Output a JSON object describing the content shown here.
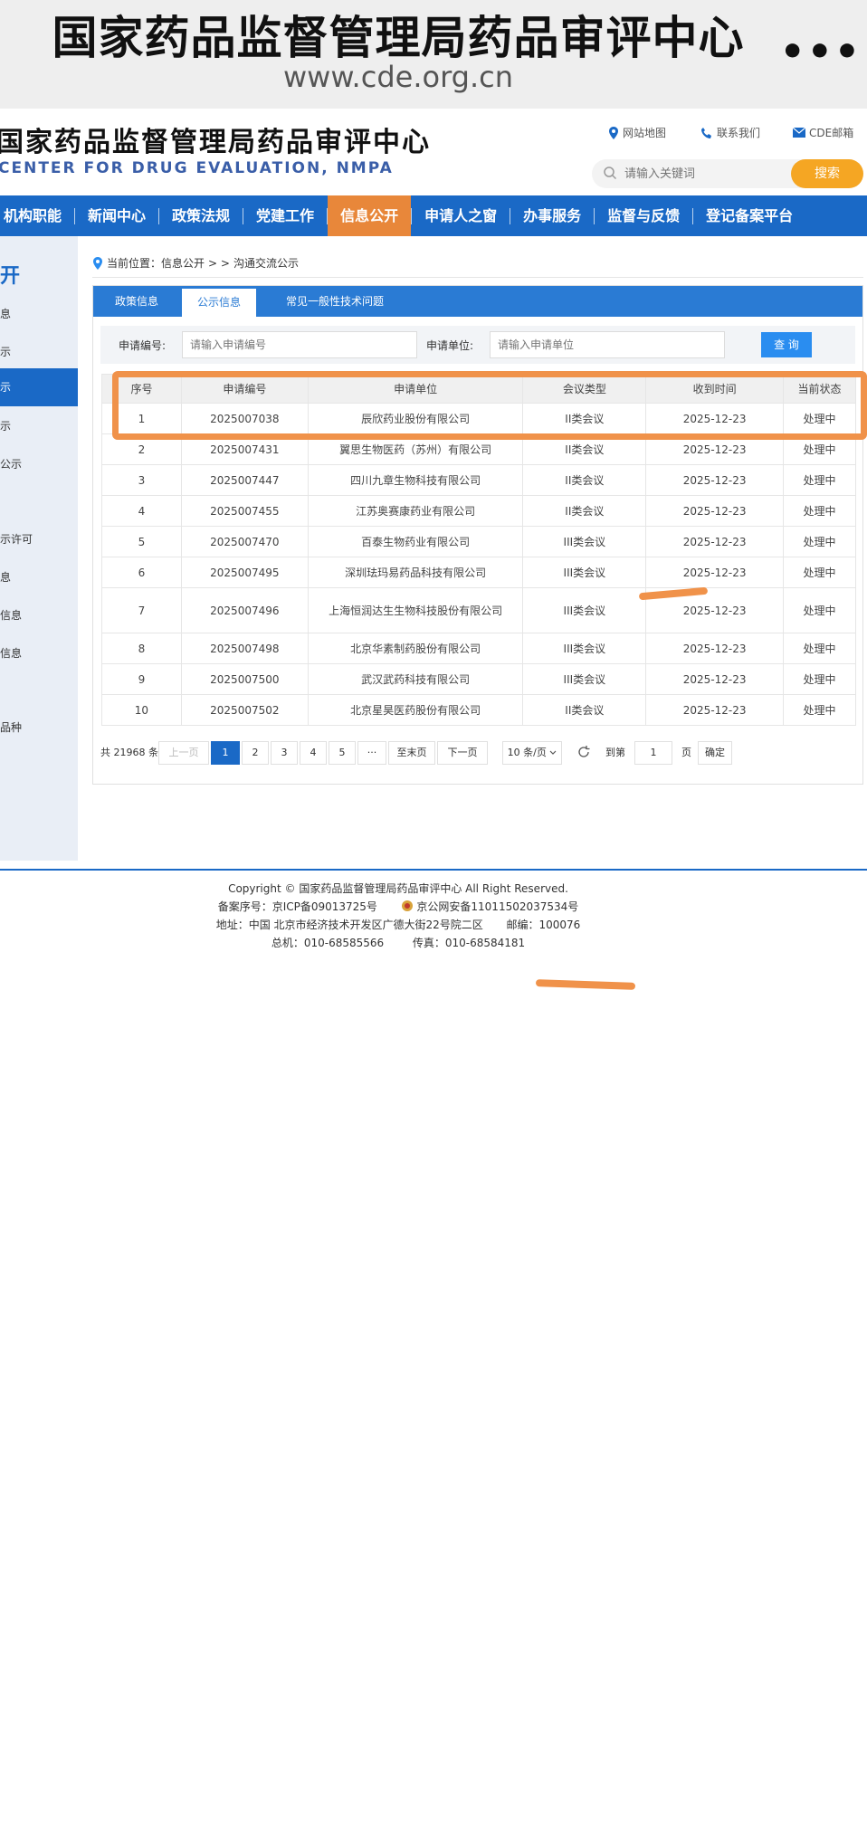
{
  "banner": {
    "title": "国家药品监督管理局药品审评中心",
    "url": "www.cde.org.cn",
    "more": "•••"
  },
  "header": {
    "site_name_cn": "国家药品监督管理局药品审评中心",
    "site_name_en": "CENTER FOR DRUG EVALUATION, NMPA",
    "links": {
      "sitemap": "网站地图",
      "contact": "联系我们",
      "mail": "CDE邮箱"
    },
    "search_placeholder": "请输入关键词",
    "search_button": "搜索"
  },
  "nav": [
    "机构职能",
    "新闻中心",
    "政策法规",
    "党建工作",
    "信息公开",
    "申请人之窗",
    "办事服务",
    "监督与反馈",
    "登记备案平台"
  ],
  "nav_active": "信息公开",
  "sidebar": {
    "title": "开",
    "items": [
      "息",
      "示",
      "示",
      "示",
      "公示",
      "",
      "示许可",
      "息",
      "信息",
      "信息",
      "",
      "品种"
    ]
  },
  "breadcrumb": {
    "label": "当前位置：信息公开",
    "sep": "> >",
    "current": "沟通交流公示"
  },
  "tabs": [
    "政策信息",
    "公示信息",
    "常见一般性技术问题"
  ],
  "filter": {
    "app_no_label": "申请编号:",
    "app_no_placeholder": "请输入申请编号",
    "unit_label": "申请单位:",
    "unit_placeholder": "请输入申请单位",
    "query_button": "查 询"
  },
  "table": {
    "headers": [
      "序号",
      "申请编号",
      "申请单位",
      "会议类型",
      "收到时间",
      "当前状态"
    ],
    "rows": [
      [
        "1",
        "2025007038",
        "辰欣药业股份有限公司",
        "II类会议",
        "2025-12-23",
        "处理中"
      ],
      [
        "2",
        "2025007431",
        "翼思生物医药（苏州）有限公司",
        "II类会议",
        "2025-12-23",
        "处理中"
      ],
      [
        "3",
        "2025007447",
        "四川九章生物科技有限公司",
        "II类会议",
        "2025-12-23",
        "处理中"
      ],
      [
        "4",
        "2025007455",
        "江苏奥赛康药业有限公司",
        "II类会议",
        "2025-12-23",
        "处理中"
      ],
      [
        "5",
        "2025007470",
        "百泰生物药业有限公司",
        "III类会议",
        "2025-12-23",
        "处理中"
      ],
      [
        "6",
        "2025007495",
        "深圳珐玛易药品科技有限公司",
        "III类会议",
        "2025-12-23",
        "处理中"
      ],
      [
        "7",
        "2025007496",
        "上海恒润达生生物科技股份有限公司",
        "III类会议",
        "2025-12-23",
        "处理中"
      ],
      [
        "8",
        "2025007498",
        "北京华素制药股份有限公司",
        "III类会议",
        "2025-12-23",
        "处理中"
      ],
      [
        "9",
        "2025007500",
        "武汉武药科技有限公司",
        "III类会议",
        "2025-12-23",
        "处理中"
      ],
      [
        "10",
        "2025007502",
        "北京星昊医药股份有限公司",
        "II类会议",
        "2025-12-23",
        "处理中"
      ]
    ]
  },
  "pager": {
    "total": "共 21968 条",
    "prev": "上一页",
    "pages": [
      "1",
      "2",
      "3",
      "4",
      "5",
      "···"
    ],
    "last": "至末页",
    "next": "下一页",
    "page_size": "10 条/页",
    "goto_label": "到第",
    "goto_value": "1",
    "page_unit": "页",
    "confirm": "确定"
  },
  "footer": {
    "copyright": "Copyright © 国家药品监督管理局药品审评中心   All Right Reserved.",
    "icp": "备案序号：京ICP备09013725号",
    "police": "京公网安备11011502037534号",
    "address": "地址：中国 北京市经济技术开发区广德大街22号院二区",
    "postcode": "邮编：100076",
    "phone": "总机：010-68585566",
    "fax": "传真：010-68584181"
  },
  "colors": {
    "nav_blue": "#1a69c6",
    "accent_orange": "#e8873a",
    "highlight": "#f0924a",
    "search_orange": "#f5a623"
  }
}
